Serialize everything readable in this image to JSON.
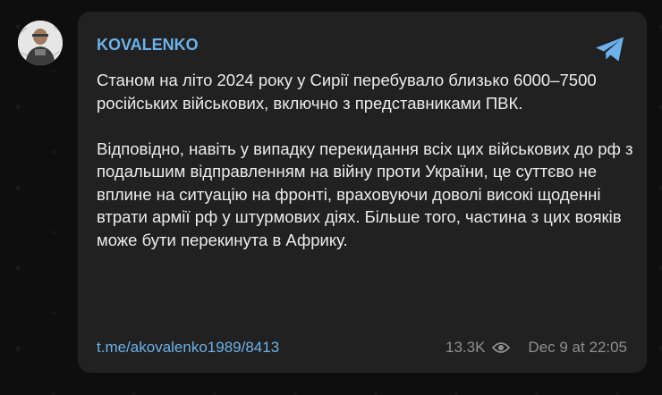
{
  "post": {
    "channel_name": "KOVALENKO",
    "paragraphs": [
      "Станом на літо 2024 року у Сирії перебувало близько 6000–7500 російських військових, включно з представниками ПВК.",
      "Відповідно, навіть у випадку перекидання всіх цих військових до рф з подальшим відправленням на війну проти України, це суттєво не вплине на ситуацію на фронті, враховуючи доволі високі щоденні втрати армії рф у штурмових діях. Більше того, частина з цих вояків може бути перекинута в Африку."
    ],
    "link": "t.me/akovalenko1989/8413",
    "views": "13.3K",
    "timestamp": "Dec 9 at 22:05"
  },
  "icons": {
    "share": "telegram-plane-icon",
    "views": "eye-icon"
  },
  "colors": {
    "background": "#0e0e0e",
    "bubble": "#212121",
    "accent": "#6cb1e9",
    "text": "#ececec",
    "meta": "#8f8f8f"
  }
}
